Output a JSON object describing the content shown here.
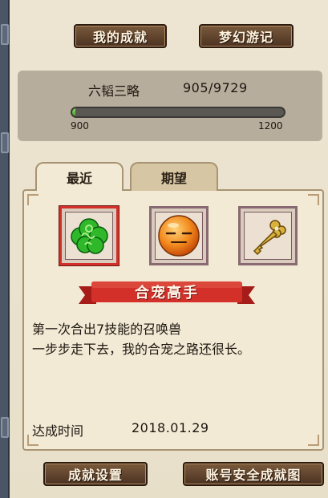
{
  "header": {
    "my_achievements_label": "我的成就",
    "dream_journey_label": "梦幻游记"
  },
  "stats": {
    "title": "六韬三略",
    "value_text": "905/9729",
    "progress_min": "900",
    "progress_max": "1200",
    "progress_fraction": 0.017
  },
  "tabs": [
    {
      "label": "最近",
      "active": true
    },
    {
      "label": "期望",
      "active": false
    }
  ],
  "items": [
    {
      "icon": "green-cloud-icon",
      "selected": true
    },
    {
      "icon": "smiley-face-icon",
      "selected": false
    },
    {
      "icon": "golden-key-icon",
      "selected": false
    }
  ],
  "achievement": {
    "name": "合宠高手",
    "description_line1": "第一次合出7技能的召唤兽",
    "description_line2": "一步步走下去，我的合宠之路还很长。",
    "date_label": "达成时间",
    "date_value": "2018.01.29"
  },
  "footer": {
    "settings_label": "成就设置",
    "security_label": "账号安全成就图"
  },
  "colors": {
    "accent_red": "#d3302a",
    "progress_green": "#5cbc3a",
    "button_brown": "#5c3e2a"
  }
}
